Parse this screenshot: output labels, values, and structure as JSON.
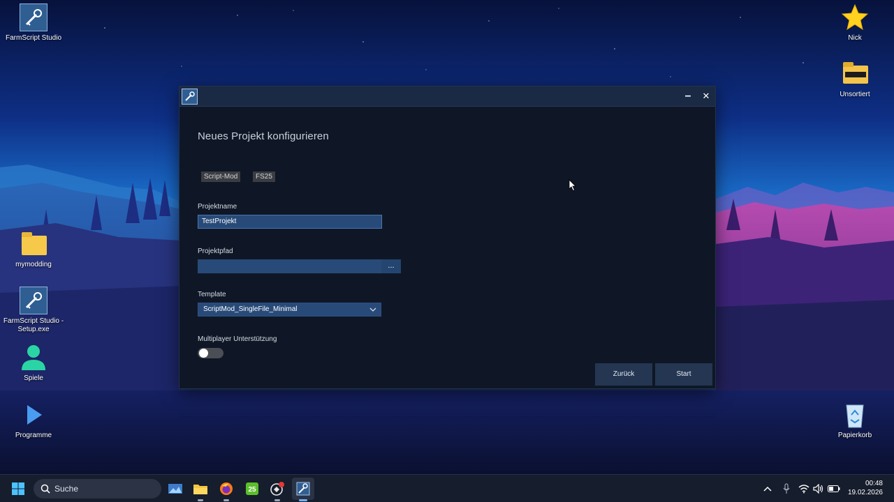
{
  "desktop": {
    "icons": [
      {
        "label": "FarmScript Studio"
      },
      {
        "label": "Nick"
      },
      {
        "label": "Unsortiert"
      },
      {
        "label": "mymodding"
      },
      {
        "label": "FarmScript Studio - Setup.exe"
      },
      {
        "label": "Spiele"
      },
      {
        "label": "Programme"
      },
      {
        "label": "Papierkorb"
      }
    ]
  },
  "dialog": {
    "title": "Neues Projekt konfigurieren",
    "tags": [
      "Script-Mod",
      "FS25"
    ],
    "fields": {
      "project_name": {
        "label": "Projektname",
        "value": "TestProjekt"
      },
      "project_path": {
        "label": "Projektpfad",
        "value": "",
        "browse_label": "..."
      },
      "template": {
        "label": "Template",
        "value": "ScriptMod_SingleFile_Minimal"
      },
      "multiplayer": {
        "label": "Multiplayer Unterstützung",
        "enabled": false
      }
    },
    "buttons": {
      "back": "Zurück",
      "start": "Start"
    },
    "window_controls": {
      "minimize": "–",
      "close": "✕"
    }
  },
  "taskbar": {
    "search_label": "Suche",
    "pinned": [
      "windows-start",
      "widgets",
      "file-explorer",
      "firefox",
      "farming-simulator",
      "game-launcher",
      "farmscript-studio"
    ],
    "clock": {
      "time": "00:48",
      "date": "19.02.2026"
    }
  },
  "colors": {
    "dialog_bg": "#0f1726",
    "titlebar_bg": "#1a2a44",
    "input_bg": "#284a78",
    "button_bg": "#243651",
    "taskbar_bg": "#161d2c"
  }
}
